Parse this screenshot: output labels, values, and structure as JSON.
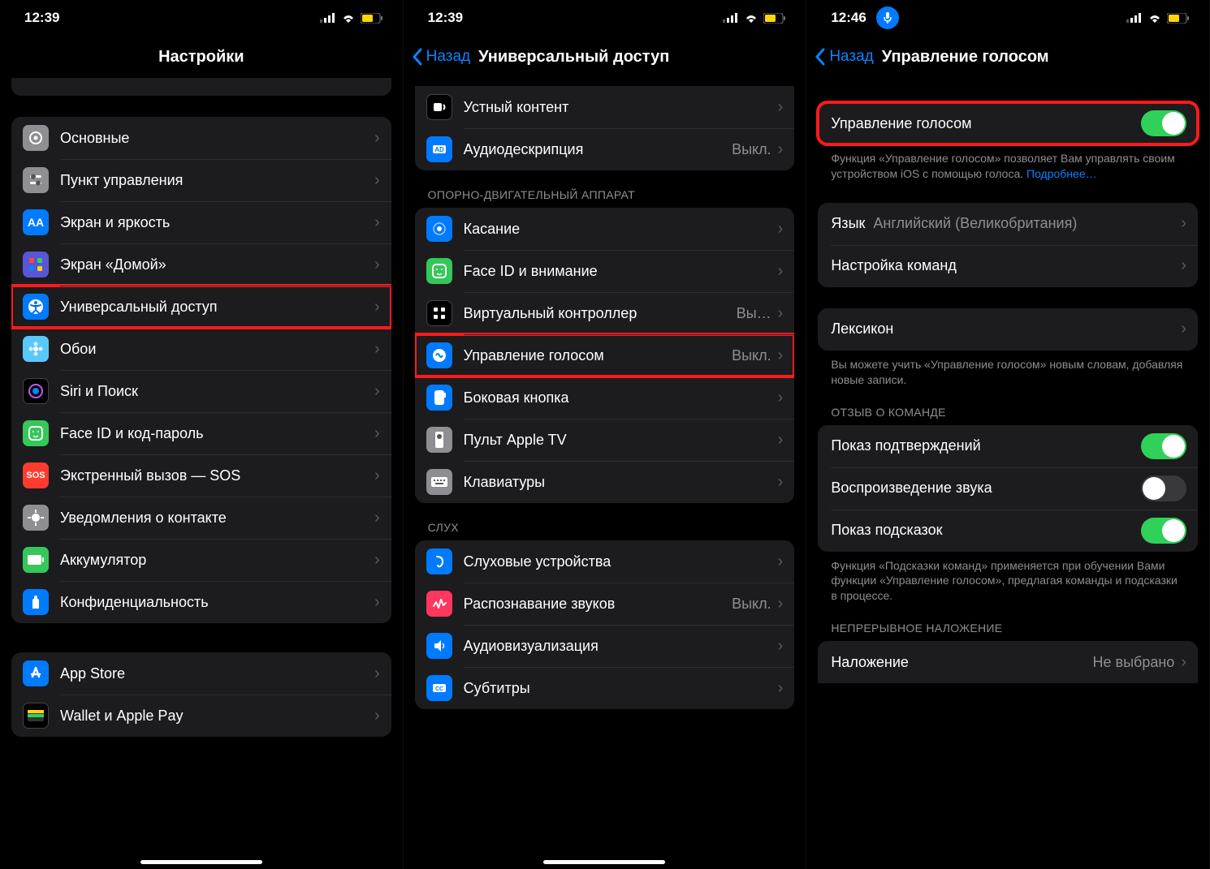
{
  "screen1": {
    "time": "12:39",
    "title": "Настройки",
    "partial_label": "",
    "items1": [
      {
        "label": "Основные",
        "icon": "gear",
        "bg": "bg-gray"
      },
      {
        "label": "Пункт управления",
        "icon": "sliders",
        "bg": "bg-gray"
      },
      {
        "label": "Экран и яркость",
        "icon": "aa",
        "bg": "bg-blue"
      },
      {
        "label": "Экран «Домой»",
        "icon": "grid",
        "bg": "bg-purple"
      },
      {
        "label": "Универсальный доступ",
        "icon": "accessibility",
        "bg": "bg-blue",
        "highlight": true
      },
      {
        "label": "Обои",
        "icon": "flower",
        "bg": "bg-cyan"
      },
      {
        "label": "Siri и Поиск",
        "icon": "siri",
        "bg": "bg-black"
      },
      {
        "label": "Face ID и код-пароль",
        "icon": "faceid",
        "bg": "bg-green"
      },
      {
        "label": "Экстренный вызов — SOS",
        "icon": "sos",
        "bg": "bg-red"
      },
      {
        "label": "Уведомления о контакте",
        "icon": "virus",
        "bg": "bg-gray"
      },
      {
        "label": "Аккумулятор",
        "icon": "battery",
        "bg": "bg-green"
      },
      {
        "label": "Конфиденциальность",
        "icon": "hand",
        "bg": "bg-blue"
      }
    ],
    "items2": [
      {
        "label": "App Store",
        "icon": "appstore",
        "bg": "bg-blue"
      },
      {
        "label": "Wallet и Apple Pay",
        "icon": "wallet",
        "bg": "bg-black"
      }
    ]
  },
  "screen2": {
    "time": "12:39",
    "back": "Назад",
    "title": "Универсальный доступ",
    "items_top": [
      {
        "label": "Устный контент",
        "icon": "speak",
        "bg": "bg-black"
      },
      {
        "label": "Аудиодескрипция",
        "icon": "ad",
        "bg": "bg-blue",
        "value": "Выкл."
      }
    ],
    "header_motor": "ОПОРНО-ДВИГАТЕЛЬНЫЙ АППАРАТ",
    "items_motor": [
      {
        "label": "Касание",
        "icon": "touch",
        "bg": "bg-blue"
      },
      {
        "label": "Face ID и внимание",
        "icon": "faceid",
        "bg": "bg-green"
      },
      {
        "label": "Виртуальный контроллер",
        "icon": "switch",
        "bg": "bg-black",
        "value": "Вы…"
      },
      {
        "label": "Управление голосом",
        "icon": "voice",
        "bg": "bg-blue",
        "value": "Выкл.",
        "highlight": true
      },
      {
        "label": "Боковая кнопка",
        "icon": "side",
        "bg": "bg-blue"
      },
      {
        "label": "Пульт Apple TV",
        "icon": "remote",
        "bg": "bg-gray"
      },
      {
        "label": "Клавиатуры",
        "icon": "keyboard",
        "bg": "bg-gray"
      }
    ],
    "header_hearing": "СЛУХ",
    "items_hearing": [
      {
        "label": "Слуховые устройства",
        "icon": "ear",
        "bg": "bg-blue"
      },
      {
        "label": "Распознавание звуков",
        "icon": "sound",
        "bg": "bg-pink",
        "value": "Выкл."
      },
      {
        "label": "Аудиовизуализация",
        "icon": "av",
        "bg": "bg-blue"
      },
      {
        "label": "Субтитры",
        "icon": "cc",
        "bg": "bg-blue"
      }
    ]
  },
  "screen3": {
    "time": "12:46",
    "back": "Назад",
    "title": "Управление голосом",
    "toggle_label": "Управление голосом",
    "toggle_state": "on",
    "toggle_footer": "Функция «Управление голосом» позволяет Вам управлять своим устройством iOS с помощью голоса.",
    "toggle_footer_link": "Подробнее…",
    "lang_row": {
      "label": "Язык",
      "value": "Английский (Великобритания)"
    },
    "commands_row": {
      "label": "Настройка команд"
    },
    "lexicon_row": {
      "label": "Лексикон"
    },
    "lexicon_footer": "Вы можете учить «Управление голосом» новым словам, добавляя новые записи.",
    "header_feedback": "ОТЗЫВ О КОМАНДЕ",
    "feedback_items": [
      {
        "label": "Показ подтверждений",
        "state": "on"
      },
      {
        "label": "Воспроизведение звука",
        "state": "off"
      },
      {
        "label": "Показ подсказок",
        "state": "on"
      }
    ],
    "feedback_footer": "Функция «Подсказки команд» применяется при обучении Вами функции «Управление голосом», предлагая команды и подсказки в процессе.",
    "header_overlay": "НЕПРЕРЫВНОЕ НАЛОЖЕНИЕ",
    "overlay_row": {
      "label": "Наложение",
      "value": "Не выбрано"
    }
  }
}
